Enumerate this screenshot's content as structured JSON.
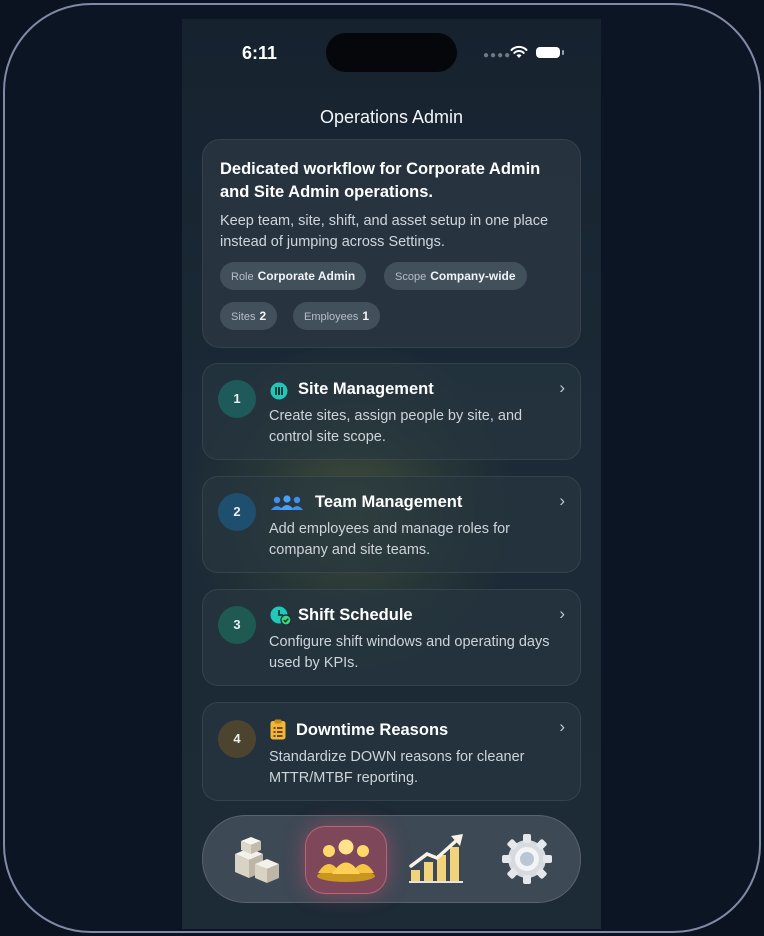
{
  "status": {
    "time": "6:11"
  },
  "header": {
    "title": "Operations Admin"
  },
  "hero": {
    "heading": "Dedicated workflow for Corporate Admin and Site Admin operations.",
    "description": "Keep team, site, shift, and asset setup in one place instead of jumping across Settings.",
    "chips": [
      {
        "key": "Role",
        "value": "Corporate Admin"
      },
      {
        "key": "Scope",
        "value": "Company-wide"
      },
      {
        "key": "Sites",
        "value": "2"
      },
      {
        "key": "Employees",
        "value": "1"
      }
    ]
  },
  "cards": [
    {
      "number": "1",
      "title": "Site Management",
      "description": "Create sites, assign people by site, and control site scope.",
      "icon": "site-icon",
      "badge_color": "#1f5a5a"
    },
    {
      "number": "2",
      "title": "Team Management",
      "description": "Add employees and manage roles for company and site teams.",
      "icon": "team-icon",
      "badge_color": "#1f4f6e"
    },
    {
      "number": "3",
      "title": "Shift Schedule",
      "description": "Configure shift windows and operating days used by KPIs.",
      "icon": "shift-clock-icon",
      "badge_color": "#1f5a52"
    },
    {
      "number": "4",
      "title": "Downtime Reasons",
      "description": "Standardize DOWN reasons for cleaner MTTR/MTBF reporting.",
      "icon": "clipboard-icon",
      "badge_color": "#4d4430"
    }
  ],
  "tabbar": {
    "active_index": 1,
    "tabs": [
      {
        "icon": "inventory-boxes-icon"
      },
      {
        "icon": "team-group-icon"
      },
      {
        "icon": "growth-chart-icon"
      },
      {
        "icon": "settings-gear-icon"
      }
    ]
  },
  "colors": {
    "accent_teal": "#21c7b8",
    "accent_blue": "#3d8ff0",
    "accent_amber": "#f2b53a",
    "active_tab": "#b4465f"
  }
}
